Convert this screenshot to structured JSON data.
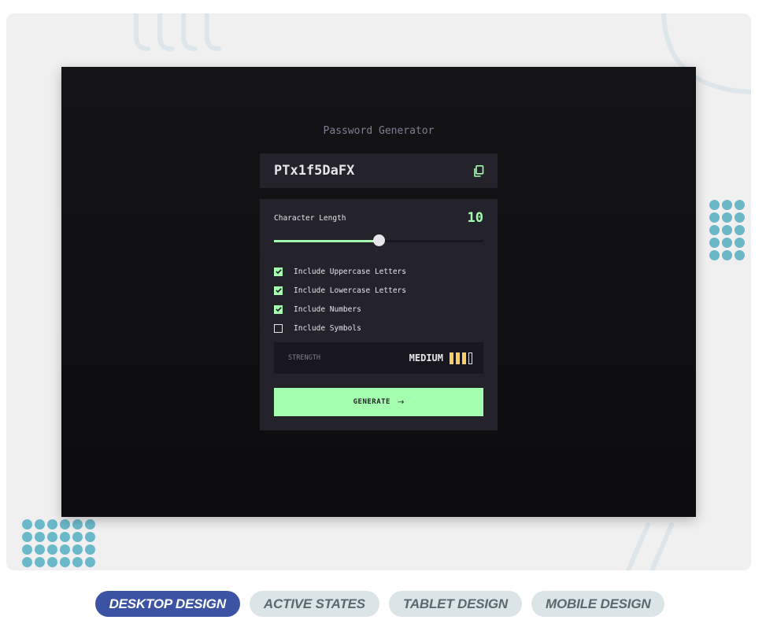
{
  "app": {
    "title": "Password Generator",
    "password": "PTx1f5DaFX",
    "copy_icon": "copy-icon"
  },
  "settings": {
    "length_label": "Character Length",
    "length_value": "10",
    "slider_fraction": 0.5,
    "options": [
      {
        "label": "Include Uppercase Letters",
        "checked": true
      },
      {
        "label": "Include Lowercase Letters",
        "checked": true
      },
      {
        "label": "Include Numbers",
        "checked": true
      },
      {
        "label": "Include Symbols",
        "checked": false
      }
    ]
  },
  "strength": {
    "label": "STRENGTH",
    "value": "MEDIUM",
    "level": 3,
    "max_level": 4
  },
  "generate": {
    "label": "GENERATE",
    "arrow_icon": "arrow-right-icon"
  },
  "tabs": [
    {
      "label": "DESKTOP DESIGN",
      "active": true
    },
    {
      "label": "ACTIVE STATES",
      "active": false
    },
    {
      "label": "TABLET DESIGN",
      "active": false
    },
    {
      "label": "MOBILE DESIGN",
      "active": false
    }
  ],
  "colors": {
    "accent_green": "#a4ffaf",
    "strength_yellow": "#f8cd65",
    "tab_active": "#3c52a3",
    "tab_inactive": "#dbe4e6",
    "dots": "#6bb8c9"
  }
}
